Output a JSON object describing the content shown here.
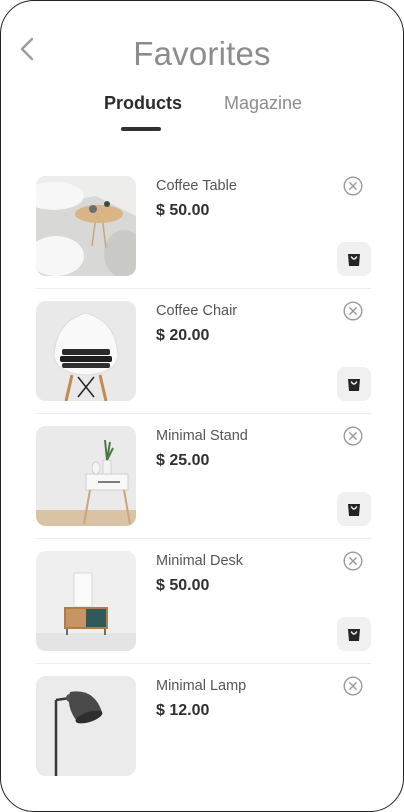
{
  "header": {
    "title": "Favorites"
  },
  "tabs": [
    {
      "label": "Products",
      "active": true
    },
    {
      "label": "Magazine",
      "active": false
    }
  ],
  "products": [
    {
      "name": "Coffee Table",
      "price": "$ 50.00",
      "image": "coffee-table-photo"
    },
    {
      "name": "Coffee Chair",
      "price": "$ 20.00",
      "image": "coffee-chair-photo"
    },
    {
      "name": "Minimal Stand",
      "price": "$ 25.00",
      "image": "minimal-stand-photo"
    },
    {
      "name": "Minimal Desk",
      "price": "$ 50.00",
      "image": "minimal-desk-photo"
    },
    {
      "name": "Minimal Lamp",
      "price": "$ 12.00",
      "image": "minimal-lamp-photo"
    }
  ],
  "icons": {
    "back": "chevron-left-icon",
    "remove": "close-circle-icon",
    "cart": "shopping-bag-icon"
  },
  "colors": {
    "title": "#8c8c8c",
    "active_tab": "#2b2b2b",
    "inactive_tab": "#8c8c8c",
    "price": "#303030",
    "cart_button_bg": "#f0f0f0"
  }
}
